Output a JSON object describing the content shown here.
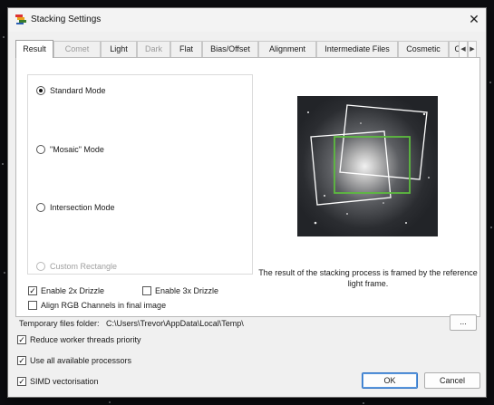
{
  "window": {
    "title": "Stacking Settings"
  },
  "tabs": [
    {
      "label": "Result",
      "active": true,
      "disabled": false
    },
    {
      "label": "Comet",
      "active": false,
      "disabled": true
    },
    {
      "label": "Light",
      "active": false,
      "disabled": false
    },
    {
      "label": "Dark",
      "active": false,
      "disabled": true
    },
    {
      "label": "Flat",
      "active": false,
      "disabled": false
    },
    {
      "label": "Bias/Offset",
      "active": false,
      "disabled": false
    },
    {
      "label": "Alignment",
      "active": false,
      "disabled": false
    },
    {
      "label": "Intermediate Files",
      "active": false,
      "disabled": false
    },
    {
      "label": "Cosmetic",
      "active": false,
      "disabled": false
    },
    {
      "label": "O",
      "active": false,
      "disabled": false
    }
  ],
  "modes": [
    {
      "label": "Standard Mode",
      "checked": true,
      "disabled": false
    },
    {
      "label": "\"Mosaic\" Mode",
      "checked": false,
      "disabled": false
    },
    {
      "label": "Intersection Mode",
      "checked": false,
      "disabled": false
    },
    {
      "label": "Custom Rectangle",
      "checked": false,
      "disabled": true
    }
  ],
  "options": {
    "drizzle2x": {
      "label": "Enable 2x Drizzle",
      "checked": true
    },
    "drizzle3x": {
      "label": "Enable 3x Drizzle",
      "checked": false
    },
    "align_rgb": {
      "label": "Align RGB Channels in final image",
      "checked": false
    }
  },
  "preview": {
    "caption": "The result of the stacking process is framed by the reference light frame.",
    "frame_color": "#5dbb3f"
  },
  "temp_folder": {
    "label": "Temporary files folder:",
    "path": "C:\\Users\\Trevor\\AppData\\Local\\Temp\\",
    "browse_label": "..."
  },
  "general": [
    {
      "label": "Reduce worker threads priority",
      "checked": true
    },
    {
      "label": "Use all available processors",
      "checked": true
    },
    {
      "label": "SIMD vectorisation",
      "checked": true
    }
  ],
  "buttons": {
    "ok": "OK",
    "cancel": "Cancel"
  },
  "colors": {
    "accent": "#2f73c6"
  }
}
